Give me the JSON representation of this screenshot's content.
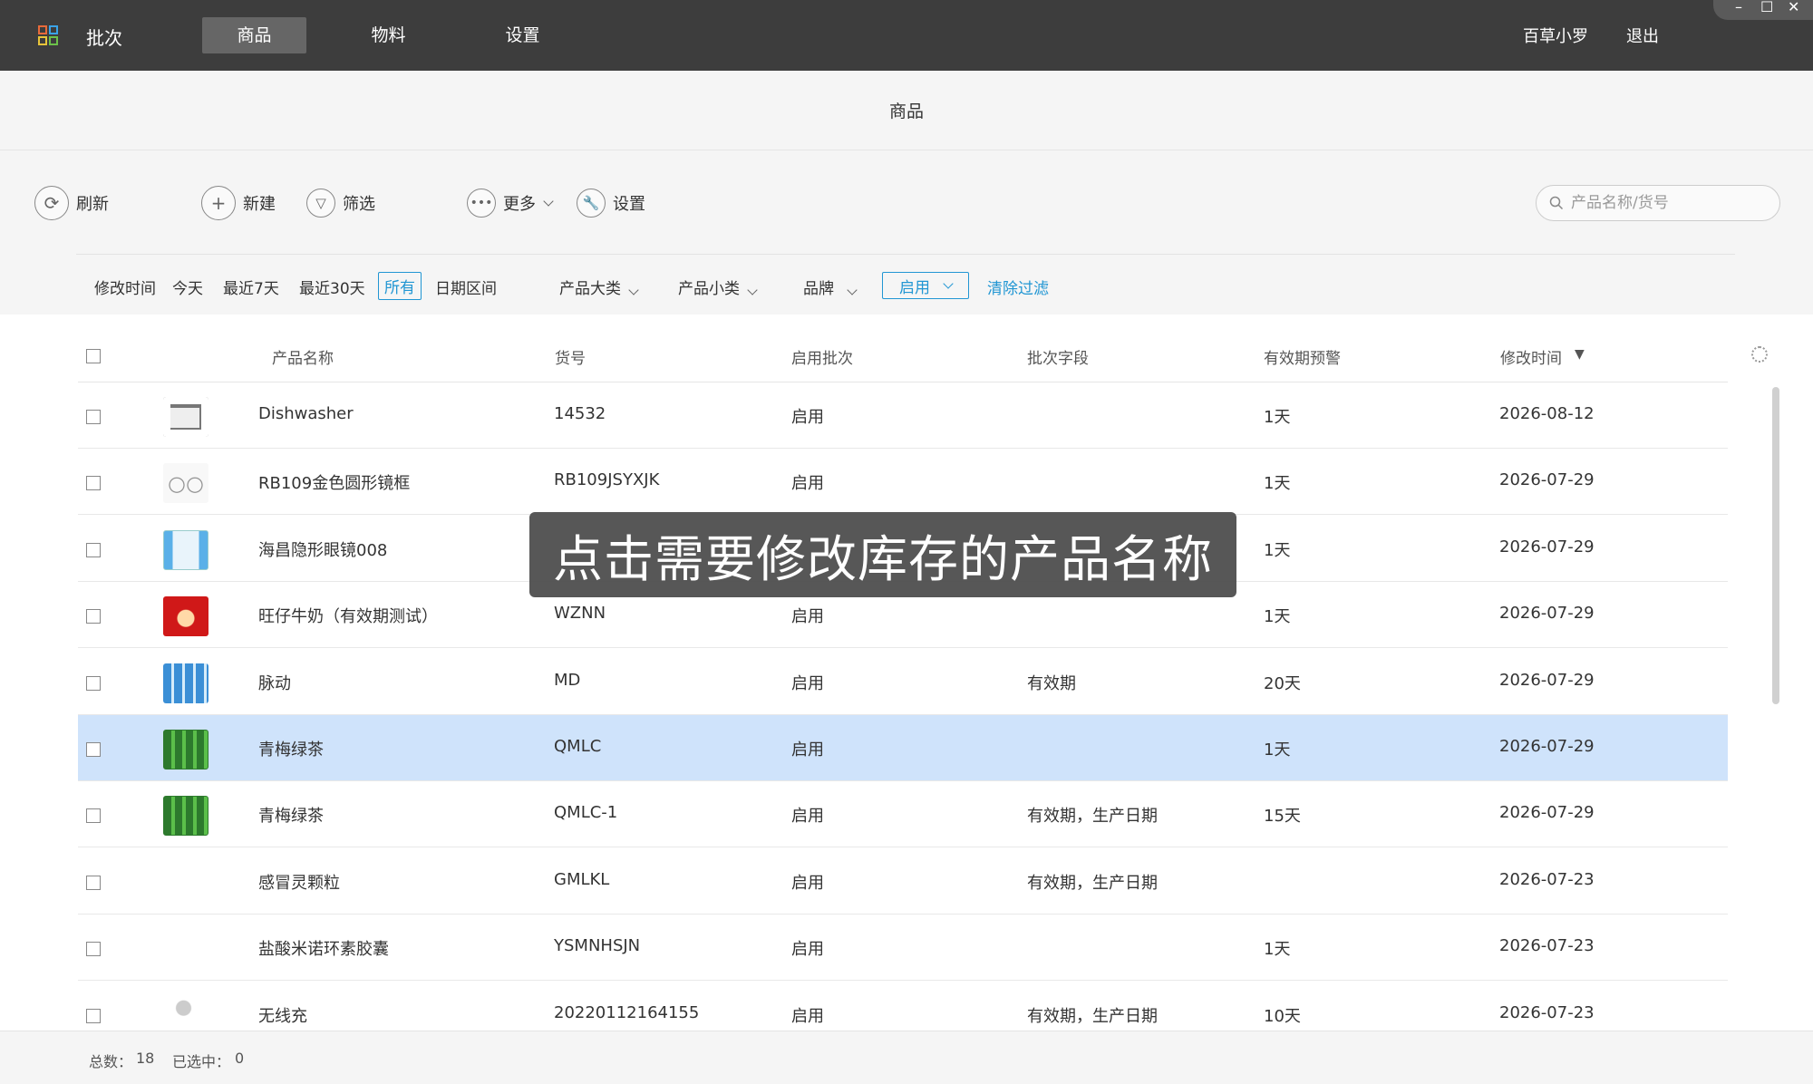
{
  "app": {
    "title": "批次",
    "nav": [
      {
        "label": "商品",
        "active": true
      },
      {
        "label": "物料",
        "active": false
      },
      {
        "label": "设置",
        "active": false
      }
    ],
    "user": "百草小罗",
    "logout": "退出",
    "window_controls": [
      "–",
      "☐",
      "✕"
    ]
  },
  "page": {
    "title": "商品"
  },
  "toolbar": {
    "refresh": "刷新",
    "new": "新建",
    "filter": "筛选",
    "more": "更多",
    "settings": "设置",
    "search_placeholder": "产品名称/货号"
  },
  "filters": {
    "modify_time": "修改时间",
    "today": "今天",
    "last7": "最近7天",
    "last30": "最近30天",
    "all": "所有",
    "date_range": "日期区间",
    "category": "产品大类",
    "subcategory": "产品小类",
    "brand": "品牌",
    "status_selected": "启用",
    "clear": "清除过滤"
  },
  "table": {
    "headers": {
      "name": "产品名称",
      "code": "货号",
      "batch_enabled": "启用批次",
      "batch_fields": "批次字段",
      "expiry_warning": "有效期预警",
      "modified": "修改时间",
      "sort_indicator": "▼"
    },
    "rows": [
      {
        "name": "Dishwasher",
        "code": "14532",
        "batch": "启用",
        "fields": "",
        "warning": "1天",
        "modified": "2026-08-12",
        "thumb": "dishwasher",
        "selected": false
      },
      {
        "name": "RB109金色圆形镜框",
        "code": "RB109JSYXJK",
        "batch": "启用",
        "fields": "",
        "warning": "1天",
        "modified": "2026-07-29",
        "thumb": "glasses",
        "selected": false
      },
      {
        "name": "海昌隐形眼镜008",
        "code": "",
        "batch": "",
        "fields": "",
        "warning": "1天",
        "modified": "2026-07-29",
        "thumb": "contact-lens-box",
        "selected": false
      },
      {
        "name": "旺仔牛奶（有效期测试）",
        "code": "WZNN",
        "batch": "启用",
        "fields": "",
        "warning": "1天",
        "modified": "2026-07-29",
        "thumb": "wangzai-logo",
        "selected": false
      },
      {
        "name": "脉动",
        "code": "MD",
        "batch": "启用",
        "fields": "有效期",
        "warning": "20天",
        "modified": "2026-07-29",
        "thumb": "drink-bottles",
        "selected": false
      },
      {
        "name": "青梅绿茶",
        "code": "QMLC",
        "batch": "启用",
        "fields": "",
        "warning": "1天",
        "modified": "2026-07-29",
        "thumb": "green-tea",
        "selected": true
      },
      {
        "name": "青梅绿茶",
        "code": "QMLC-1",
        "batch": "启用",
        "fields": "有效期，生产日期",
        "warning": "15天",
        "modified": "2026-07-29",
        "thumb": "green-tea",
        "selected": false
      },
      {
        "name": "感冒灵颗粒",
        "code": "GMLKL",
        "batch": "启用",
        "fields": "有效期，生产日期",
        "warning": "",
        "modified": "2026-07-23",
        "thumb": "",
        "selected": false
      },
      {
        "name": "盐酸米诺环素胶囊",
        "code": "YSMNHSJN",
        "batch": "启用",
        "fields": "",
        "warning": "1天",
        "modified": "2026-07-23",
        "thumb": "",
        "selected": false
      },
      {
        "name": "无线充",
        "code": "20220112164155",
        "batch": "启用",
        "fields": "有效期，生产日期",
        "warning": "10天",
        "modified": "2026-07-23",
        "thumb": "charger",
        "selected": false
      }
    ]
  },
  "footer": {
    "total_label": "总数：",
    "total": "18",
    "selected_label": "已选中：",
    "selected": "0"
  },
  "overlay": {
    "tooltip": "点击需要修改库存的产品名称"
  },
  "colors": {
    "accent": "#2196d3",
    "topbar": "#3d3d3d",
    "selected_row": "#cfe3fb"
  }
}
